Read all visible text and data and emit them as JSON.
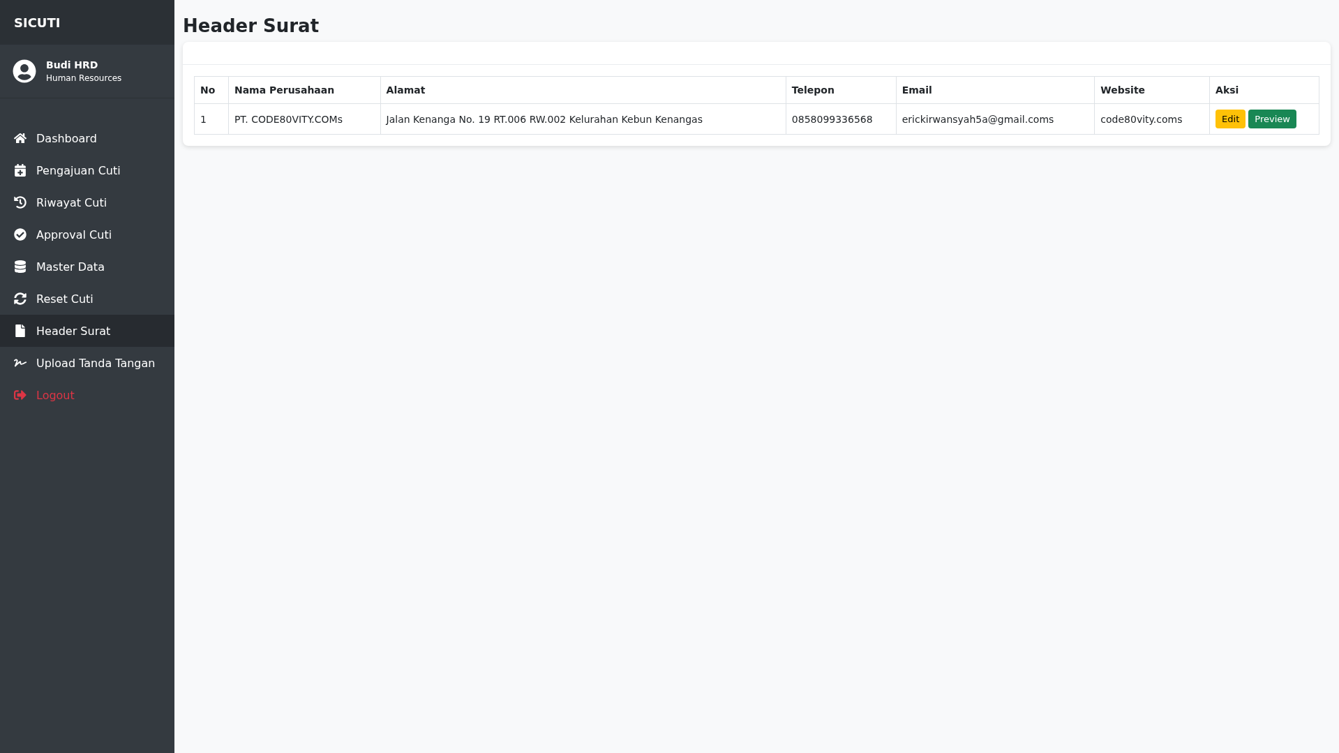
{
  "sidebar": {
    "brand": "SICUTI",
    "user": {
      "name": "Budi HRD",
      "role": "Human Resources"
    },
    "items": [
      {
        "label": "Dashboard",
        "selected": false,
        "kind": "link"
      },
      {
        "label": "Pengajuan Cuti",
        "selected": false,
        "kind": "link"
      },
      {
        "label": "Riwayat Cuti",
        "selected": false,
        "kind": "link"
      },
      {
        "label": "Approval Cuti",
        "selected": false,
        "kind": "link"
      },
      {
        "label": "Master Data",
        "selected": false,
        "kind": "link"
      },
      {
        "label": "Reset Cuti",
        "selected": false,
        "kind": "link"
      },
      {
        "label": "Header Surat",
        "selected": true,
        "kind": "link"
      },
      {
        "label": "Upload Tanda Tangan",
        "selected": false,
        "kind": "link"
      },
      {
        "label": "Logout",
        "selected": false,
        "kind": "danger"
      }
    ]
  },
  "page_title": "Header Surat",
  "table": {
    "columns": [
      "No",
      "Nama Perusahaan",
      "Alamat",
      "Telepon",
      "Email",
      "Website",
      "Aksi"
    ],
    "rows": [
      {
        "cells": [
          "1",
          "PT. CODE80VITY.COMs",
          "Jalan Kenanga No. 19 RT.006 RW.002 Kelurahan Kebun Kenangas",
          "0858099336568",
          "erickirwansyah5a@gmail.coms",
          "code80vity.coms"
        ],
        "actions": [
          {
            "label": "Edit",
            "kind": "warning"
          },
          {
            "label": "Preview",
            "kind": "success"
          }
        ]
      }
    ]
  }
}
